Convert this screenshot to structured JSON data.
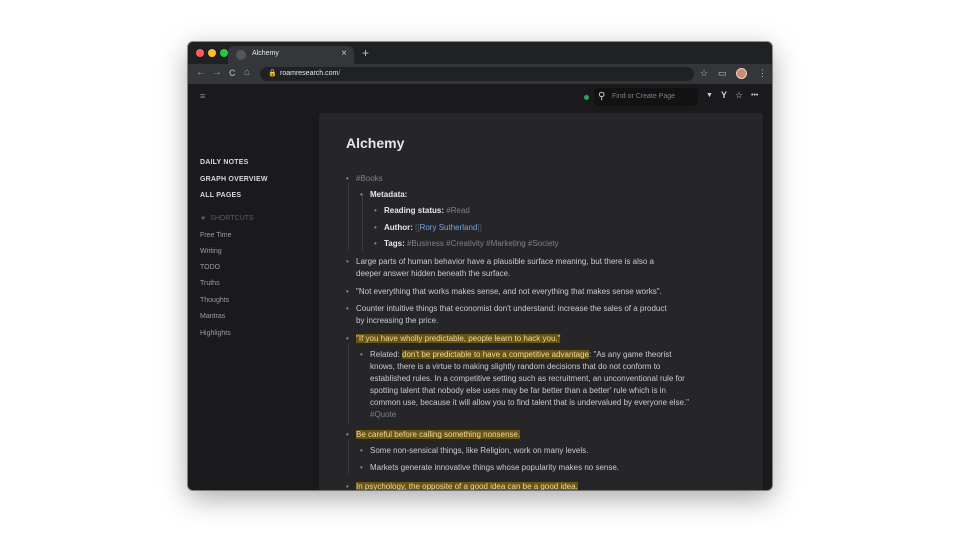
{
  "browser": {
    "tab_title": "Alchemy",
    "tab_close": "×",
    "new_tab": "+",
    "url_domain": "roamresearch.com",
    "url_path": "/",
    "back": "←",
    "forward": "→",
    "reload": "C",
    "home": "⌂",
    "lock": "🔒",
    "star": "☆",
    "cast": "▭",
    "menu": "⋮",
    "traffic_colors": [
      "#ff5f57",
      "#febc2e",
      "#28c840"
    ]
  },
  "app": {
    "sidebar_toggle": "≡",
    "search_icon": "⚲",
    "search_placeholder": "Find or Create Page",
    "filter_icon": "▼",
    "graph_icon": "Y",
    "star_icon": "☆",
    "more_icon": "•••"
  },
  "sidebar": {
    "daily_notes": "DAILY NOTES",
    "graph_overview": "GRAPH OVERVIEW",
    "all_pages": "ALL PAGES",
    "shortcuts_star": "★",
    "shortcuts_label": "SHORTCUTS",
    "items": [
      "Free Time",
      "Writing",
      "TODO",
      "Truths",
      "Thoughts",
      "Mantras",
      "Highlights"
    ]
  },
  "page": {
    "title": "Alchemy",
    "bullet": "•",
    "books_tag": "#Books",
    "metadata": "Metadata:",
    "reading_status_label": "Reading status:",
    "reading_status_value": "#Read",
    "author_label": "Author:",
    "author_open": "[[",
    "author_name": "Rory Sutherland",
    "author_close": "]]",
    "tags_label": "Tags:",
    "tags_value": "#Business #Creativity #Marketing #Society",
    "b1_line1": "Large parts of human behavior have a plausible surface meaning, but there is also a",
    "b1_line2": "deeper answer hidden beneath the surface.",
    "b2": "\"Not everything that works makes sense, and not everything that makes sense works\".",
    "b3_line1": "Counter intuitive things that economist don't understand: increase the sales of a product",
    "b3_line2": "by increasing the price.",
    "b4": "\"If you have wholly predictable, people learn to hack you.\"",
    "b4_related_prefix": "Related: ",
    "b4_related_hl": "don't be predictable to have a competitive advantage",
    "b4_related_rest": ": \"As any game theorist",
    "b4_l2": "knows, there is a virtue to making slightly random decisions that do not conform to",
    "b4_l3": "established rules. In a competitive setting such as recruitment, an unconventional rule for",
    "b4_l4": "spotting talent that nobody else uses may be far better than a better' rule which is in",
    "b4_l5": "common use, because it will allow you to find talent that is undervalued by everyone else.\"",
    "b4_quote": "#Quote",
    "b5": "Be careful before calling something nonsense.",
    "b5_c1": "Some non-sensical things, like Religion, work on many levels.",
    "b5_c2": "Markets generate innovative things whose popularity makes no sense.",
    "b6": "In psychology, the opposite of a good idea can be a good idea."
  }
}
